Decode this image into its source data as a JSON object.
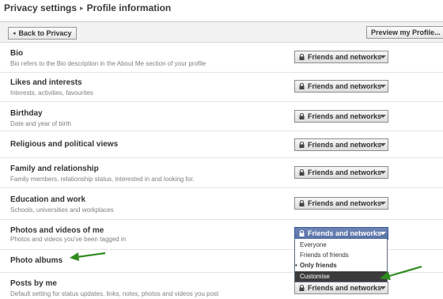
{
  "header": {
    "breadcrumb_parent": "Privacy settings",
    "breadcrumb_separator": "▸",
    "breadcrumb_current": "Profile information"
  },
  "toolbar": {
    "back_label": "Back to Privacy",
    "preview_label": "Preview my Profile..."
  },
  "dropdown_default_label": "Friends and networks",
  "settings": [
    {
      "title": "Bio",
      "description": "Bio refers to the Bio description in the About Me section of your profile",
      "value": "Friends and networks"
    },
    {
      "title": "Likes and interests",
      "description": "Interests, activities, favourites",
      "value": "Friends and networks"
    },
    {
      "title": "Birthday",
      "description": "Date and year of birth",
      "value": "Friends and networks"
    },
    {
      "title": "Religious and political views",
      "description": "",
      "value": "Friends and networks"
    },
    {
      "title": "Family and relationship",
      "description": "Family members, relationship status, interested in and looking for.",
      "value": "Friends and networks"
    },
    {
      "title": "Education and work",
      "description": "Schools, universities and workplaces",
      "value": "Friends and networks"
    },
    {
      "title": "Photos and videos of me",
      "description": "Photos and videos you've been tagged in",
      "value": "Friends and networks"
    },
    {
      "title": "Photo albums",
      "description": "",
      "value": ""
    },
    {
      "title": "Posts by me",
      "description": "Default setting for status updates, links, notes, photos and videos you post",
      "value": "Friends and networks"
    }
  ],
  "open_menu": {
    "options": [
      "Everyone",
      "Friends of friends",
      "Only friends",
      "Customise"
    ],
    "selected": "Only friends",
    "highlighted": "Customise",
    "bullet": "•"
  },
  "colors": {
    "annotation_arrow": "#2e8b1e",
    "active_dropdown": "#5f78ab",
    "menu_highlight": "#3b3b3b"
  }
}
